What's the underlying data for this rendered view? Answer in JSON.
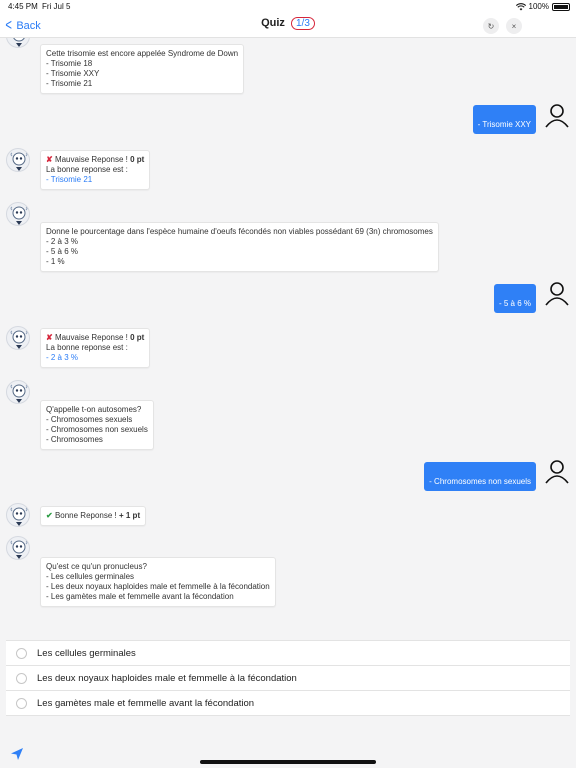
{
  "status_bar": {
    "time": "4:45 PM",
    "date": "Fri Jul 5",
    "battery": "100%"
  },
  "nav": {
    "back_label": "Back",
    "title": "Quiz",
    "counter": "1/3",
    "refresh_icon": "↻",
    "close_icon": "×"
  },
  "messages": [
    {
      "sender": "bot",
      "lines": [
        "Cette trisomie est encore appelée Syndrome de Down",
        "- Trisomie 18",
        "- Trisomie XXY",
        "- Trisomie 21"
      ]
    },
    {
      "sender": "user",
      "text": "- Trisomie XXY"
    },
    {
      "sender": "bot",
      "result_prefix": "Mauvaise Reponse ! ",
      "result_points": "0 pt",
      "answer_label": "La bonne reponse est :",
      "answer": "- Trisomie 21"
    },
    {
      "sender": "bot",
      "lines": [
        "Donne le pourcentage dans l'espèce humaine d'oeufs fécondés non viables possédant 69 (3n) chromosomes",
        "- 2 à 3 %",
        "- 5 à 6 %",
        "- 1 %"
      ]
    },
    {
      "sender": "user",
      "text": "- 5 à 6 %"
    },
    {
      "sender": "bot",
      "result_prefix": "Mauvaise Reponse ! ",
      "result_points": "0 pt",
      "answer_label": "La bonne reponse est :",
      "answer": "- 2 à 3 %"
    },
    {
      "sender": "bot",
      "lines": [
        "Q'appelle t-on autosomes?",
        "- Chromosomes sexuels",
        "- Chromosomes non sexuels",
        "- Chromosomes"
      ]
    },
    {
      "sender": "user",
      "text": "- Chromosomes non sexuels"
    },
    {
      "sender": "bot",
      "result_prefix": "Bonne Reponse ! ",
      "result_points": "+ 1 pt"
    },
    {
      "sender": "bot",
      "lines": [
        "Qu'est ce qu'un pronucleus?",
        "- Les cellules germinales",
        "- Les deux noyaux haploides male et femmelle à la fécondation",
        "- Les gamètes male et femmelle avant la fécondation"
      ]
    }
  ],
  "options": [
    "Les cellules germinales",
    "Les deux noyaux haploides male et femmelle à la fécondation",
    "Les gamètes male et femmelle avant la fécondation"
  ],
  "colors": {
    "accent": "#2f80f6",
    "wrong": "#d6263b",
    "correct": "#2e9d45"
  },
  "icons": {
    "wrong": "✘",
    "correct": "✔",
    "send": "paper-plane-icon"
  }
}
